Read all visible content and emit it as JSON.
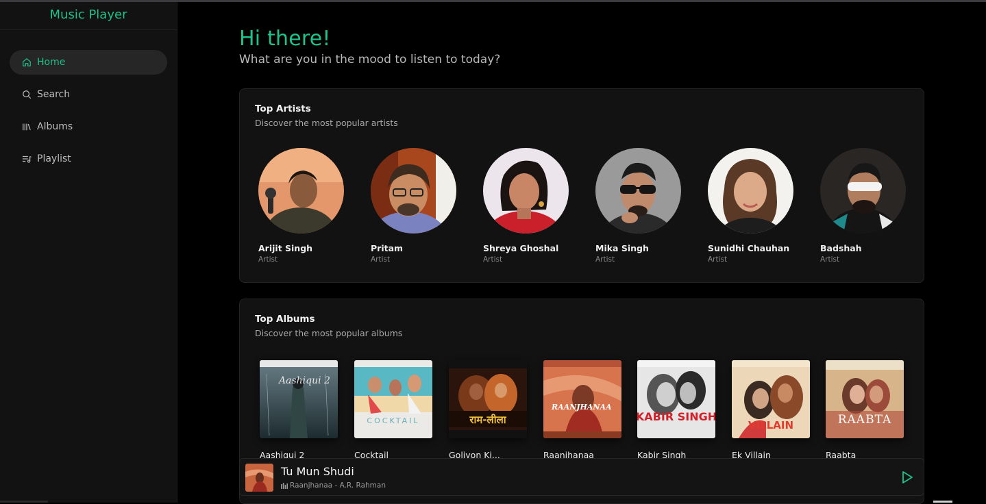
{
  "app": {
    "title": "Music Player"
  },
  "sidebar": {
    "items": [
      {
        "label": "Home",
        "icon": "home-icon",
        "active": true
      },
      {
        "label": "Search",
        "icon": "search-icon",
        "active": false
      },
      {
        "label": "Albums",
        "icon": "library-icon",
        "active": false
      },
      {
        "label": "Playlist",
        "icon": "playlist-icon",
        "active": false
      }
    ]
  },
  "greeting": {
    "title": "Hi there!",
    "subtitle": "What are you in the mood to listen to today?"
  },
  "top_artists": {
    "title": "Top Artists",
    "subtitle": "Discover the most popular artists",
    "items": [
      {
        "name": "Arijit Singh",
        "role": "Artist"
      },
      {
        "name": "Pritam",
        "role": "Artist"
      },
      {
        "name": "Shreya Ghoshal",
        "role": "Artist"
      },
      {
        "name": "Mika Singh",
        "role": "Artist"
      },
      {
        "name": "Sunidhi Chauhan",
        "role": "Artist"
      },
      {
        "name": "Badshah",
        "role": "Artist"
      }
    ]
  },
  "top_albums": {
    "title": "Top Albums",
    "subtitle": "Discover the most popular albums",
    "items": [
      {
        "name": "Aashiqui 2",
        "cover_text": "Aashiqui 2"
      },
      {
        "name": "Cocktail",
        "cover_text": "COCKTAIL"
      },
      {
        "name": "Goliyon Ki...",
        "cover_text": "राम-लीला"
      },
      {
        "name": "Raanjhanaa",
        "cover_text": "RAANJHANAA"
      },
      {
        "name": "Kabir Singh",
        "cover_text": "KABIR SINGH"
      },
      {
        "name": "Ek Villain",
        "cover_text": "VILLAIN"
      },
      {
        "name": "Raabta",
        "cover_text": "RAABTA"
      }
    ]
  },
  "player": {
    "title": "Tu Mun Shudi",
    "meta": "Raanjhanaa - A.R. Rahman"
  },
  "colors": {
    "accent": "#1ec28b",
    "background": "#000000",
    "card": "#121212"
  }
}
